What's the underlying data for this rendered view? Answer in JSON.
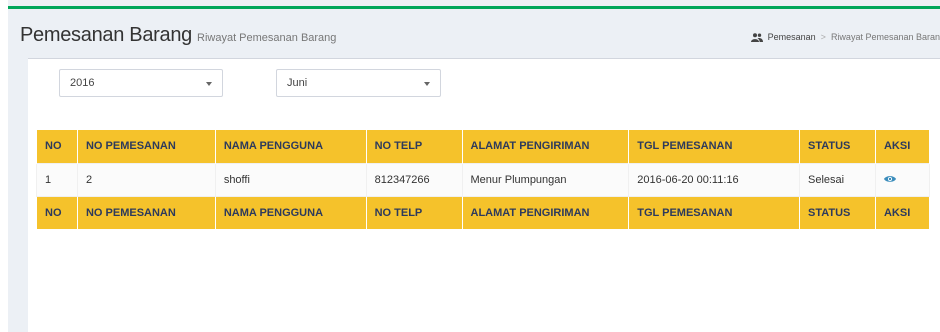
{
  "header": {
    "title": "Pemesanan Barang",
    "subtitle": "Riwayat Pemesanan Barang"
  },
  "breadcrumb": {
    "items": [
      "Pemesanan",
      "Riwayat Pemesanan Baran"
    ],
    "separator": ">"
  },
  "filters": {
    "year": "2016",
    "month": "Juni"
  },
  "table": {
    "columns": [
      "NO",
      "NO PEMESANAN",
      "NAMA PENGGUNA",
      "NO TELP",
      "ALAMAT PENGIRIMAN",
      "TGL PEMESANAN",
      "STATUS",
      "AKSI"
    ],
    "rows": [
      [
        "1",
        "2",
        "shoffi",
        "812347266",
        "Menur Plumpungan",
        "2016-06-20 00:11:16",
        "Selesai"
      ]
    ]
  },
  "colors": {
    "accent_green": "#00a65a",
    "header_yellow": "#f5c22b",
    "eye_blue": "#3c8dbc"
  },
  "icons": {
    "breadcrumb": "users-icon",
    "action": "eye-icon"
  }
}
